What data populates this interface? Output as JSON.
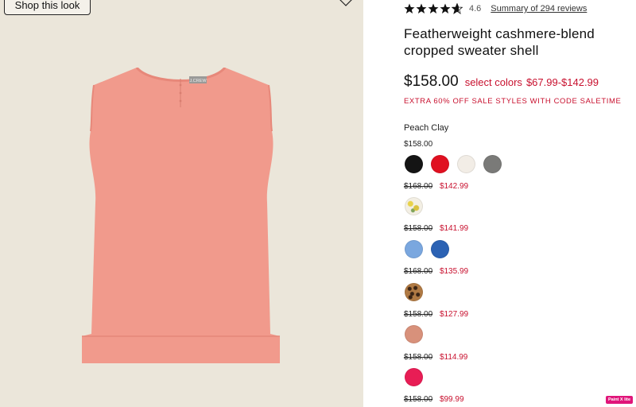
{
  "left_panel": {
    "shop_button_label": "Shop this look",
    "heart_icon": "heart-outline-icon",
    "image_brand_tag": "J.CREW",
    "product_color": "#f19a8c"
  },
  "header": {
    "rating": "4.6",
    "reviews_link": "Summary of 294 reviews",
    "star_fill_fraction": 0.92
  },
  "product": {
    "title": "Featherweight cashmere-blend cropped sweater shell",
    "price": "$158.00",
    "select_colors_label": "select colors",
    "sale_range": "$67.99-$142.99",
    "promo": "EXTRA 60% OFF SALE STYLES WITH CODE SALETIME",
    "selected_color_name": "Peach Clay"
  },
  "color_groups": [
    {
      "regular_price": "$158.00",
      "swatches": [
        "#141414",
        "#e01020",
        "#f2ede6",
        "#7a7a78"
      ]
    },
    {
      "original_price": "$168.00",
      "sale_price": "$142.99",
      "swatches": [
        "pattern-floral"
      ]
    },
    {
      "original_price": "$158.00",
      "sale_price": "$141.99",
      "swatches": [
        "#7aa7df",
        "#2b62b4"
      ]
    },
    {
      "original_price": "$168.00",
      "sale_price": "$135.99",
      "swatches": [
        "pattern-leopard"
      ]
    },
    {
      "original_price": "$158.00",
      "sale_price": "$127.99",
      "swatches": [
        "#d8917b"
      ]
    },
    {
      "original_price": "$158.00",
      "sale_price": "$114.99",
      "swatches": [
        "#e81d55"
      ]
    },
    {
      "original_price": "$158.00",
      "sale_price": "$99.99",
      "swatches": []
    }
  ],
  "badge": "Paint X lite",
  "colors": {
    "sale_red": "#c8102e",
    "panel_bg": "#ebe6da"
  }
}
